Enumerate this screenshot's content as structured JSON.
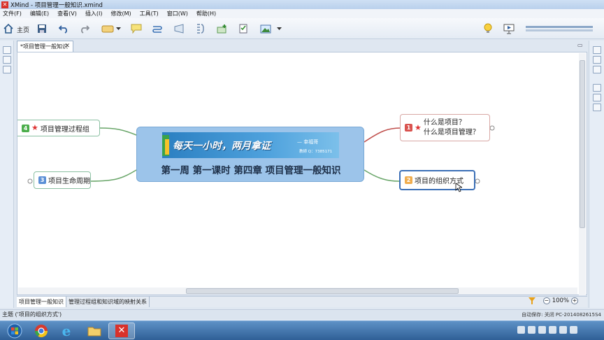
{
  "window": {
    "title": "XMind - 项目管理一般知识.xmind"
  },
  "menu": [
    "文件(F)",
    "编辑(E)",
    "查看(V)",
    "插入(I)",
    "修改(M)",
    "工具(T)",
    "窗口(W)",
    "帮助(H)"
  ],
  "toolbar": {
    "home_label": "主页"
  },
  "editor_tab": {
    "label": "*项目管理一般知识",
    "close": "✕"
  },
  "map": {
    "central": {
      "banner_slogan": "每天一小时，两月拿证",
      "banner_teacher": "— 幸福哥",
      "banner_qq": "教師 Q：7385171",
      "title": "第一周 第一课时 第四章 项目管理一般知识"
    },
    "topics": [
      {
        "number": "1",
        "line1": "什么是项目？",
        "line2": "什么是项目管理？",
        "badge_color": "#d9534f",
        "starred": true
      },
      {
        "number": "2",
        "label": "项目的组织方式",
        "badge_color": "#f0ad4e",
        "starred": false
      },
      {
        "number": "3",
        "label": "项目生命周期",
        "badge_color": "#5b8fd6",
        "starred": false
      },
      {
        "number": "4",
        "label": "项目管理过程组",
        "badge_color": "#4cae4c",
        "starred": true
      }
    ]
  },
  "sheets": [
    "项目管理一般知识",
    "管理过程组和知识域的映射关系"
  ],
  "zoom": {
    "value": "100%"
  },
  "status": {
    "left": "主题 ('项目的组织方式')",
    "right": "自动保存: 关闭  PC-2014082615S4"
  },
  "colors": {
    "central_fill": "#9cc4ea",
    "selected_border": "#3b6fb6",
    "link_red": "#c0504d",
    "link_green": "#6aa66a"
  }
}
